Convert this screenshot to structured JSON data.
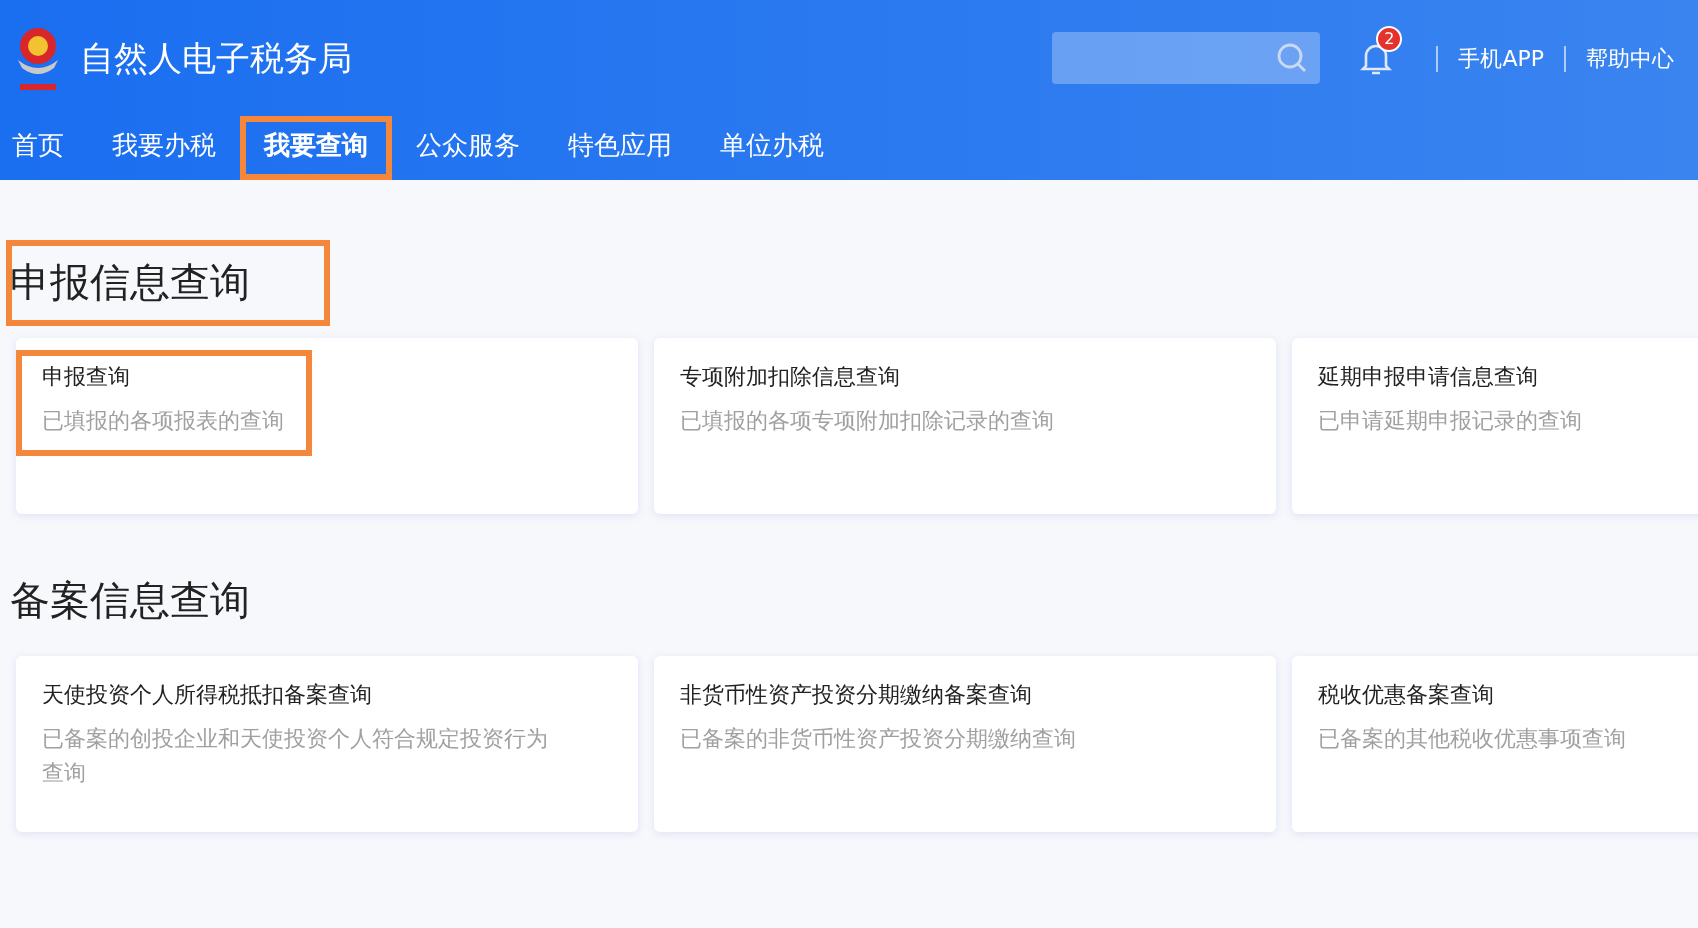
{
  "header": {
    "title": "自然人电子税务局",
    "notifications": {
      "count": "2"
    },
    "links": [
      "手机APP",
      "帮助中心"
    ]
  },
  "nav": [
    {
      "label": "首页",
      "selected": false,
      "highlighted": false
    },
    {
      "label": "我要办税",
      "selected": false,
      "highlighted": false
    },
    {
      "label": "我要查询",
      "selected": true,
      "highlighted": true
    },
    {
      "label": "公众服务",
      "selected": false,
      "highlighted": false
    },
    {
      "label": "特色应用",
      "selected": false,
      "highlighted": false
    },
    {
      "label": "单位办税",
      "selected": false,
      "highlighted": false
    }
  ],
  "sections": [
    {
      "title": "申报信息查询",
      "highlighted": true,
      "cards": [
        {
          "title": "申报查询",
          "description": "已填报的各项报表的查询",
          "highlighted": true
        },
        {
          "title": "专项附加扣除信息查询",
          "description": "已填报的各项专项附加扣除记录的查询",
          "highlighted": false
        },
        {
          "title": "延期申报申请信息查询",
          "description": "已申请延期申报记录的查询",
          "highlighted": false
        }
      ]
    },
    {
      "title": "备案信息查询",
      "highlighted": false,
      "cards": [
        {
          "title": "天使投资个人所得税抵扣备案查询",
          "description": "已备案的创投企业和天使投资个人符合规定投资行为查询",
          "highlighted": false
        },
        {
          "title": "非货币性资产投资分期缴纳备案查询",
          "description": "已备案的非货币性资产投资分期缴纳查询",
          "highlighted": false
        },
        {
          "title": "税收优惠备案查询",
          "description": "已备案的其他税收优惠事项查询",
          "highlighted": false
        }
      ]
    }
  ]
}
